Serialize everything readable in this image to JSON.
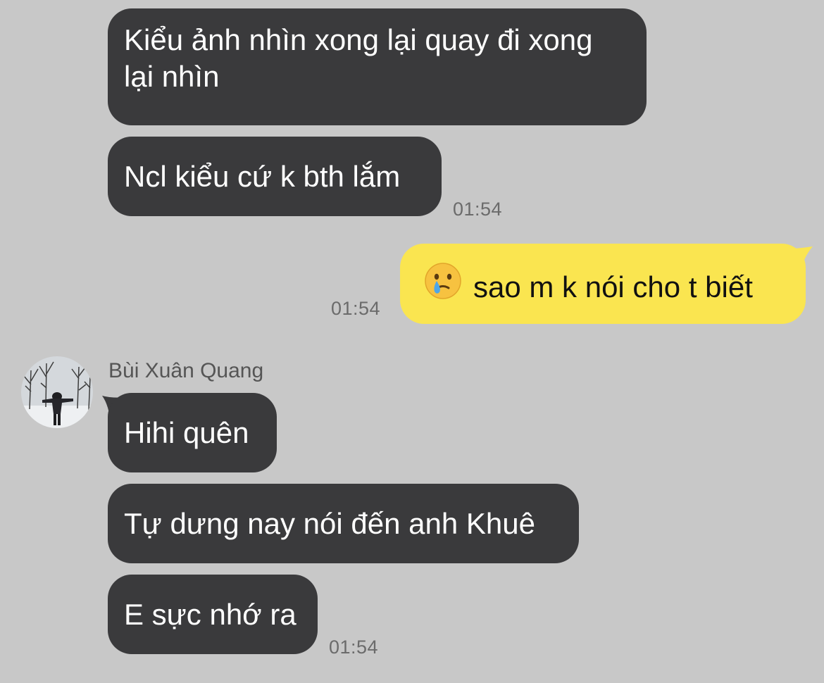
{
  "messages": [
    {
      "text": "Kiểu ảnh nhìn xong lại quay đi xong lại nhìn"
    },
    {
      "text": "Ncl kiểu cứ k bth lắm",
      "time": "01:54"
    },
    {
      "text": "sao m k nói cho t biết",
      "time": "01:54",
      "emoji": "crying-face-emoji"
    },
    {
      "sender": "Bùi Xuân Quang",
      "text": "Hihi quên"
    },
    {
      "text": "Tự dưng nay nói đến anh Khuê"
    },
    {
      "text": "E sực nhớ ra",
      "time": "01:54"
    }
  ],
  "colors": {
    "background": "#c8c8c8",
    "incoming_bubble": "#3a3a3c",
    "outgoing_bubble": "#fae550",
    "timestamp": "#6b6b6b"
  }
}
